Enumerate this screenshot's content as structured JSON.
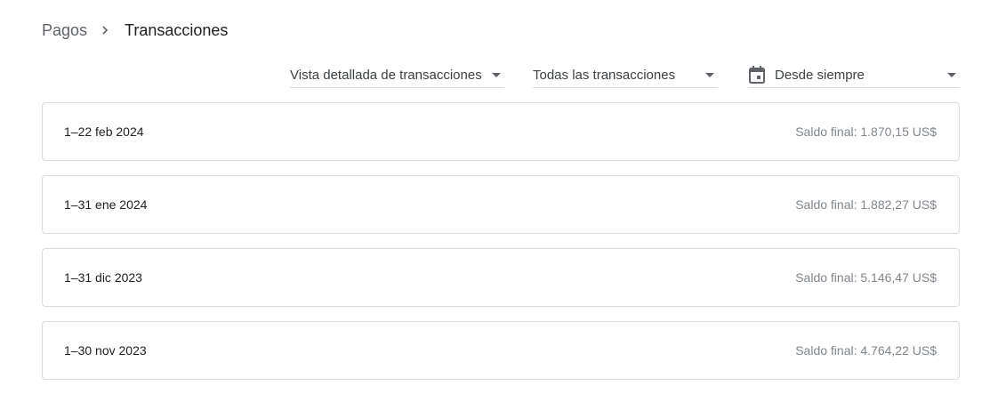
{
  "breadcrumb": {
    "parent": "Pagos",
    "separator_icon": "chevron-right-icon",
    "current": "Transacciones"
  },
  "filters": {
    "view": {
      "value": "Vista detallada de transacciones",
      "icon": "arrow-drop-down-icon"
    },
    "type": {
      "value": "Todas las transacciones",
      "icon": "arrow-drop-down-icon"
    },
    "date": {
      "value": "Desde siempre",
      "leading_icon": "calendar-icon",
      "icon": "arrow-drop-down-icon"
    }
  },
  "statements": [
    {
      "period": "1–22 feb 2024",
      "balance": "Saldo final: 1.870,15 US$"
    },
    {
      "period": "1–31 ene 2024",
      "balance": "Saldo final: 1.882,27 US$"
    },
    {
      "period": "1–31 dic 2023",
      "balance": "Saldo final: 5.146,47 US$"
    },
    {
      "period": "1–30 nov 2023",
      "balance": "Saldo final: 4.764,22 US$"
    }
  ],
  "colors": {
    "text_primary": "#202124",
    "text_secondary": "#5f6368",
    "text_muted": "#80868b",
    "border": "#dadce0"
  }
}
